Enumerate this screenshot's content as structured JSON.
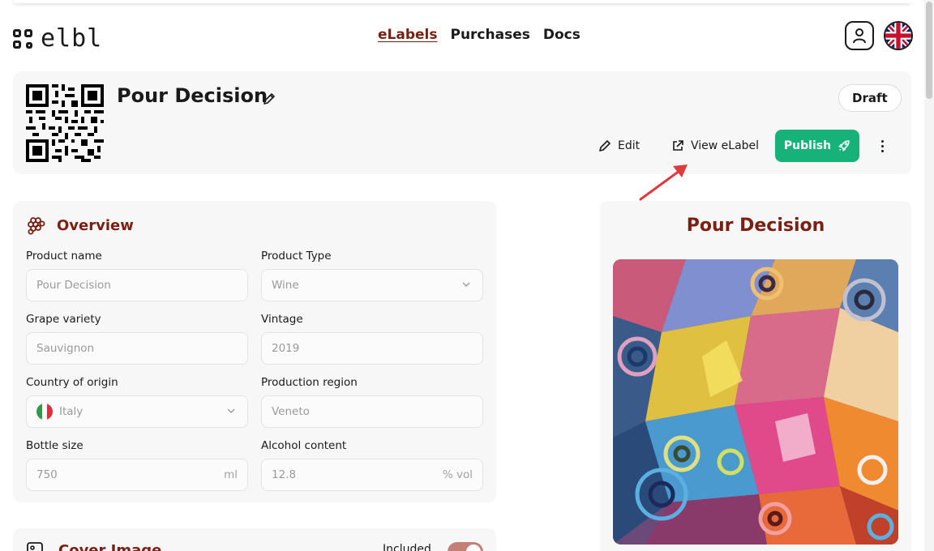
{
  "app": {
    "logo_text": "elbl"
  },
  "nav": {
    "items": [
      {
        "label": "eLabels",
        "active": true
      },
      {
        "label": "Purchases",
        "active": false
      },
      {
        "label": "Docs",
        "active": false
      }
    ]
  },
  "header": {
    "user_icon": "user-icon",
    "language_icon": "uk-flag-icon"
  },
  "product": {
    "title": "Pour Decision",
    "status": "Draft",
    "actions": {
      "edit_label": "Edit",
      "view_label": "View eLabel",
      "publish_label": "Publish"
    }
  },
  "overview": {
    "title": "Overview",
    "fields": {
      "product_name": {
        "label": "Product name",
        "value": "Pour Decision"
      },
      "product_type": {
        "label": "Product Type",
        "value": "Wine"
      },
      "grape_variety": {
        "label": "Grape variety",
        "value": "Sauvignon"
      },
      "vintage": {
        "label": "Vintage",
        "value": "2019"
      },
      "country": {
        "label": "Country of origin",
        "value": "Italy"
      },
      "region": {
        "label": "Production region",
        "value": "Veneto"
      },
      "bottle_size": {
        "label": "Bottle size",
        "value": "750",
        "unit": "ml"
      },
      "alcohol": {
        "label": "Alcohol content",
        "value": "12.8",
        "unit": "% vol"
      }
    }
  },
  "cover_image": {
    "title": "Cover Image",
    "included_label": "Included",
    "included": true
  },
  "preview": {
    "title": "Pour Decision"
  },
  "colors": {
    "brand": "#7a1f12",
    "publish": "#16b27a",
    "card_bg": "#f7f7f7",
    "annotation_arrow": "#e0393e"
  }
}
